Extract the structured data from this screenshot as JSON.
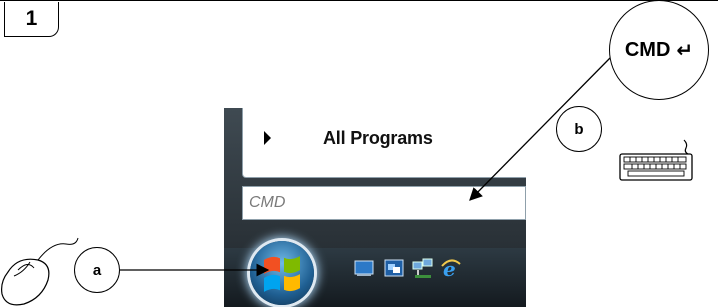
{
  "step": {
    "number": "1"
  },
  "start_menu": {
    "all_programs_label": "All Programs",
    "search_text": "CMD"
  },
  "callouts": {
    "command_label": "CMD",
    "enter_key_glyph": "↵",
    "label_b": "b",
    "label_a": "a"
  },
  "icons": {
    "mouse": "mouse-icon",
    "keyboard": "keyboard-icon",
    "start_orb": "windows-start-orb-icon",
    "right_arrow": "triangle-right-icon",
    "taskbar_show_desktop": "show-desktop-icon",
    "taskbar_switch_windows": "switch-windows-icon",
    "taskbar_network": "network-icon",
    "taskbar_browser": "internet-explorer-icon"
  },
  "colors": {
    "taskbar_dark": "#1f262b",
    "orb_blue": "#1f5f92",
    "callout_stroke": "#000000"
  }
}
